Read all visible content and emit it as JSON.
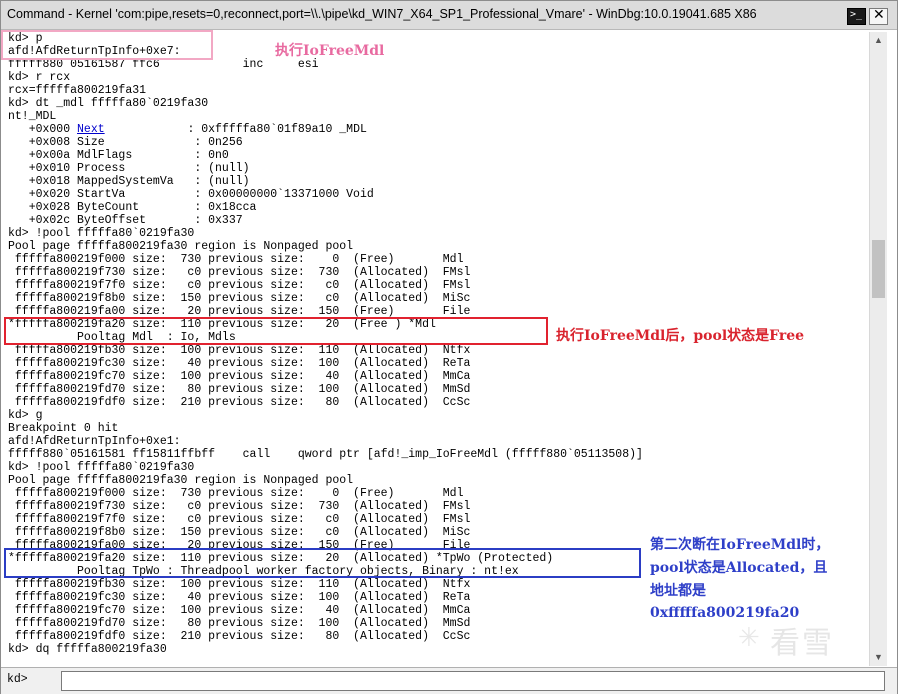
{
  "window": {
    "title": "Command - Kernel 'com:pipe,resets=0,reconnect,port=\\\\.\\pipe\\kd_WIN7_X64_SP1_Professional_Vmare' - WinDbg:10.0.19041.685 X86",
    "close_glyph": "✕",
    "cmd_glyph": ">_"
  },
  "output_lines": [
    {
      "text": "kd> p"
    },
    {
      "text": "afd!AfdReturnTpInfo+0xe7:"
    },
    {
      "text": "fffff880`05161587 ffc6            inc     esi"
    },
    {
      "text": "kd> r rcx"
    },
    {
      "text": "rcx=fffffa800219fa31"
    },
    {
      "text": "kd> dt _mdl fffffa80`0219fa30"
    },
    {
      "text": "nt!_MDL"
    },
    {
      "pre": "   +0x000 ",
      "link": "Next",
      "post": "            : 0xfffffa80`01f89a10 _MDL"
    },
    {
      "text": "   +0x008 Size             : 0n256"
    },
    {
      "text": "   +0x00a MdlFlags         : 0n0"
    },
    {
      "text": "   +0x010 Process          : (null)"
    },
    {
      "text": "   +0x018 MappedSystemVa   : (null)"
    },
    {
      "text": "   +0x020 StartVa          : 0x00000000`13371000 Void"
    },
    {
      "text": "   +0x028 ByteCount        : 0x18cca"
    },
    {
      "text": "   +0x02c ByteOffset       : 0x337"
    },
    {
      "text": "kd> !pool fffffa80`0219fa30"
    },
    {
      "text": "Pool page fffffa800219fa30 region is Nonpaged pool"
    },
    {
      "text": " fffffa800219f000 size:  730 previous size:    0  (Free)       Mdl"
    },
    {
      "text": " fffffa800219f730 size:   c0 previous size:  730  (Allocated)  FMsl"
    },
    {
      "text": " fffffa800219f7f0 size:   c0 previous size:   c0  (Allocated)  FMsl"
    },
    {
      "text": " fffffa800219f8b0 size:  150 previous size:   c0  (Allocated)  MiSc"
    },
    {
      "text": " fffffa800219fa00 size:   20 previous size:  150  (Free)       File"
    },
    {
      "text": "*fffffa800219fa20 size:  110 previous size:   20  (Free ) *Mdl"
    },
    {
      "text": "          Pooltag Mdl  : Io, Mdls"
    },
    {
      "text": " fffffa800219fb30 size:  100 previous size:  110  (Allocated)  Ntfx"
    },
    {
      "text": " fffffa800219fc30 size:   40 previous size:  100  (Allocated)  ReTa"
    },
    {
      "text": " fffffa800219fc70 size:  100 previous size:   40  (Allocated)  MmCa"
    },
    {
      "text": " fffffa800219fd70 size:   80 previous size:  100  (Allocated)  MmSd"
    },
    {
      "text": " fffffa800219fdf0 size:  210 previous size:   80  (Allocated)  CcSc"
    },
    {
      "text": "kd> g"
    },
    {
      "text": "Breakpoint 0 hit"
    },
    {
      "text": "afd!AfdReturnTpInfo+0xe1:"
    },
    {
      "text": "fffff880`05161581 ff15811ffbff    call    qword ptr [afd!_imp_IoFreeMdl (fffff880`05113508)]"
    },
    {
      "text": "kd> !pool fffffa80`0219fa30"
    },
    {
      "text": "Pool page fffffa800219fa30 region is Nonpaged pool"
    },
    {
      "text": " fffffa800219f000 size:  730 previous size:    0  (Free)       Mdl"
    },
    {
      "text": " fffffa800219f730 size:   c0 previous size:  730  (Allocated)  FMsl"
    },
    {
      "text": " fffffa800219f7f0 size:   c0 previous size:   c0  (Allocated)  FMsl"
    },
    {
      "text": " fffffa800219f8b0 size:  150 previous size:   c0  (Allocated)  MiSc"
    },
    {
      "text": " fffffa800219fa00 size:   20 previous size:  150  (Free)       File"
    },
    {
      "text": "*fffffa800219fa20 size:  110 previous size:   20  (Allocated) *TpWo (Protected)"
    },
    {
      "text": "          Pooltag TpWo : Threadpool worker factory objects, Binary : nt!ex"
    },
    {
      "text": " fffffa800219fb30 size:  100 previous size:  110  (Allocated)  Ntfx"
    },
    {
      "text": " fffffa800219fc30 size:   40 previous size:  100  (Allocated)  ReTa"
    },
    {
      "text": " fffffa800219fc70 size:  100 previous size:   40  (Allocated)  MmCa"
    },
    {
      "text": " fffffa800219fd70 size:   80 previous size:  100  (Allocated)  MmSd"
    },
    {
      "text": " fffffa800219fdf0 size:  210 previous size:   80  (Allocated)  CcSc"
    },
    {
      "text": "kd> dq fffffa800219fa30"
    }
  ],
  "command_bar": {
    "prompt": "kd>",
    "input_value": ""
  },
  "annotations": {
    "note1": "执行IoFreeMdl",
    "note2": "执行IoFreeMdl后，pool状态是Free",
    "note3_lines": [
      "第二次断在IoFreeMdl时，",
      "pool状态是Allocated，且",
      "地址都是",
      "0xfffffa800219fa20"
    ],
    "colors": {
      "pink": "#e86aa0",
      "red": "#d9232d",
      "blue": "#2e3fc8"
    }
  },
  "watermark": {
    "text": "看雪",
    "icon": "snowflake-icon"
  }
}
